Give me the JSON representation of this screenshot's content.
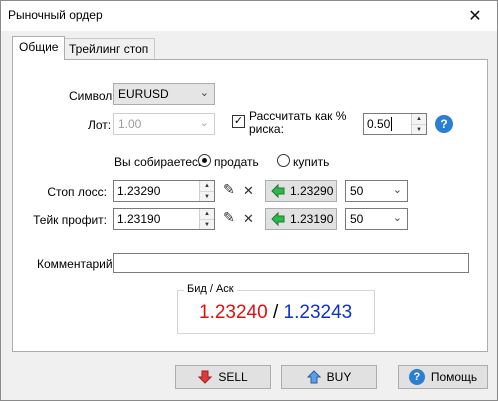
{
  "window": {
    "title": "Рыночный ордер",
    "close_icon": "close-icon"
  },
  "tabs": [
    {
      "label": "Общие",
      "active": true
    },
    {
      "label": "Трейлинг стоп",
      "active": false
    }
  ],
  "form": {
    "symbol_label": "Символ:",
    "symbol_value": "EURUSD",
    "lot_label": "Лот:",
    "lot_value": "1.00",
    "risk_checkbox_checked": true,
    "risk_label_line1": "Рассчитать как %",
    "risk_label_line2": "риска:",
    "risk_value": "0.50",
    "intent_label": "Вы собираетесь",
    "sell_option": "продать",
    "buy_option": "купить",
    "selected_option": "sell",
    "stoploss_label": "Стоп лосс:",
    "stoploss_value": "1.23290",
    "stoploss_price_button": "1.23290",
    "stoploss_points": "50",
    "takeprofit_label": "Тейк профит:",
    "takeprofit_value": "1.23190",
    "takeprofit_price_button": "1.23190",
    "takeprofit_points": "50",
    "comment_label": "Комментарий:",
    "comment_value": ""
  },
  "quote": {
    "group_title": "Бид / Аск",
    "bid": "1.23240",
    "separator": "/",
    "ask": "1.23243",
    "bid_color": "#e01010",
    "ask_color": "#1030d0"
  },
  "buttons": {
    "sell": "SELL",
    "buy": "BUY",
    "help": "Помощь"
  }
}
